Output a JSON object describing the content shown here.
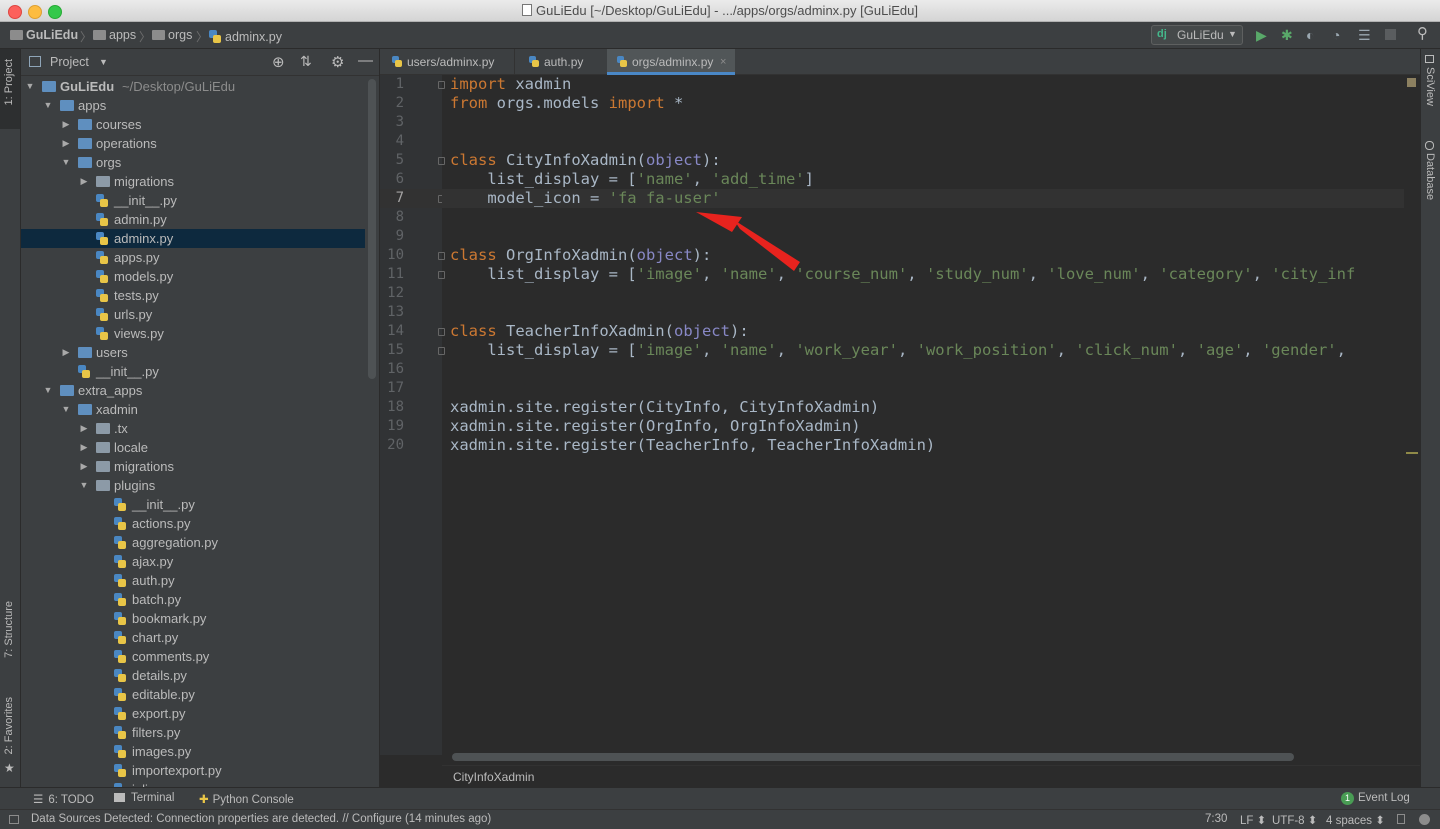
{
  "window": {
    "title": "GuLiEdu [~/Desktop/GuLiEdu] - .../apps/orgs/adminx.py [GuLiEdu]"
  },
  "navbar": {
    "crumbs": [
      "GuLiEdu",
      "apps",
      "orgs",
      "adminx.py"
    ],
    "run_config": "GuLiEdu",
    "run_config_badge": "dj"
  },
  "left_strip": {
    "project_tab": "1: Project",
    "structure_tab": "7: Structure",
    "favorites_tab": "2: Favorites"
  },
  "project_panel": {
    "header_label": "Project",
    "tree": [
      {
        "label": "GuLiEdu",
        "suffix": "~/Desktop/GuLiEdu",
        "depth": 0,
        "kind": "folder",
        "arrow": "down",
        "bold": true
      },
      {
        "label": "apps",
        "depth": 1,
        "kind": "folder",
        "arrow": "down"
      },
      {
        "label": "courses",
        "depth": 2,
        "kind": "folder",
        "arrow": "right"
      },
      {
        "label": "operations",
        "depth": 2,
        "kind": "folder",
        "arrow": "right"
      },
      {
        "label": "orgs",
        "depth": 2,
        "kind": "folder",
        "arrow": "down"
      },
      {
        "label": "migrations",
        "depth": 3,
        "kind": "folder",
        "arrow": "right"
      },
      {
        "label": "__init__.py",
        "depth": 3,
        "kind": "py"
      },
      {
        "label": "admin.py",
        "depth": 3,
        "kind": "py"
      },
      {
        "label": "adminx.py",
        "depth": 3,
        "kind": "py",
        "selected": true
      },
      {
        "label": "apps.py",
        "depth": 3,
        "kind": "py"
      },
      {
        "label": "models.py",
        "depth": 3,
        "kind": "py"
      },
      {
        "label": "tests.py",
        "depth": 3,
        "kind": "py"
      },
      {
        "label": "urls.py",
        "depth": 3,
        "kind": "py"
      },
      {
        "label": "views.py",
        "depth": 3,
        "kind": "py"
      },
      {
        "label": "users",
        "depth": 2,
        "kind": "folder",
        "arrow": "right"
      },
      {
        "label": "__init__.py",
        "depth": 2,
        "kind": "py"
      },
      {
        "label": "extra_apps",
        "depth": 1,
        "kind": "folder",
        "arrow": "down"
      },
      {
        "label": "xadmin",
        "depth": 2,
        "kind": "folder",
        "arrow": "down"
      },
      {
        "label": ".tx",
        "depth": 3,
        "kind": "folder",
        "arrow": "right"
      },
      {
        "label": "locale",
        "depth": 3,
        "kind": "folder",
        "arrow": "right"
      },
      {
        "label": "migrations",
        "depth": 3,
        "kind": "folder",
        "arrow": "right"
      },
      {
        "label": "plugins",
        "depth": 3,
        "kind": "folder",
        "arrow": "down"
      },
      {
        "label": "__init__.py",
        "depth": 4,
        "kind": "py"
      },
      {
        "label": "actions.py",
        "depth": 4,
        "kind": "py"
      },
      {
        "label": "aggregation.py",
        "depth": 4,
        "kind": "py"
      },
      {
        "label": "ajax.py",
        "depth": 4,
        "kind": "py"
      },
      {
        "label": "auth.py",
        "depth": 4,
        "kind": "py"
      },
      {
        "label": "batch.py",
        "depth": 4,
        "kind": "py"
      },
      {
        "label": "bookmark.py",
        "depth": 4,
        "kind": "py"
      },
      {
        "label": "chart.py",
        "depth": 4,
        "kind": "py"
      },
      {
        "label": "comments.py",
        "depth": 4,
        "kind": "py"
      },
      {
        "label": "details.py",
        "depth": 4,
        "kind": "py"
      },
      {
        "label": "editable.py",
        "depth": 4,
        "kind": "py"
      },
      {
        "label": "export.py",
        "depth": 4,
        "kind": "py"
      },
      {
        "label": "filters.py",
        "depth": 4,
        "kind": "py"
      },
      {
        "label": "images.py",
        "depth": 4,
        "kind": "py"
      },
      {
        "label": "importexport.py",
        "depth": 4,
        "kind": "py"
      },
      {
        "label": "inline.py",
        "depth": 4,
        "kind": "py"
      }
    ]
  },
  "editor": {
    "tabs": [
      {
        "label": "users/adminx.py",
        "active": false
      },
      {
        "label": "auth.py",
        "active": false
      },
      {
        "label": "orgs/adminx.py",
        "active": true
      }
    ],
    "current_line": 7,
    "lines": [
      [
        [
          "kw",
          "import"
        ],
        [
          "t",
          " xadmin"
        ]
      ],
      [
        [
          "kw",
          "from"
        ],
        [
          "t",
          " orgs.models "
        ],
        [
          "kw",
          "import"
        ],
        [
          "t",
          " *"
        ]
      ],
      [],
      [],
      [
        [
          "kw",
          "class"
        ],
        [
          "t",
          " CityInfoXadmin("
        ],
        [
          "bi",
          "object"
        ],
        [
          "t",
          "):"
        ]
      ],
      [
        [
          "t",
          "    list_display = ["
        ],
        [
          "str",
          "'name'"
        ],
        [
          "t",
          ", "
        ],
        [
          "str",
          "'add_time'"
        ],
        [
          "t",
          "]"
        ]
      ],
      [
        [
          "t",
          "    model_icon = "
        ],
        [
          "str",
          "'fa fa-user'"
        ]
      ],
      [],
      [],
      [
        [
          "kw",
          "class"
        ],
        [
          "t",
          " OrgInfoXadmin("
        ],
        [
          "bi",
          "object"
        ],
        [
          "t",
          "):"
        ]
      ],
      [
        [
          "t",
          "    list_display = ["
        ],
        [
          "str",
          "'image'"
        ],
        [
          "t",
          ", "
        ],
        [
          "str",
          "'name'"
        ],
        [
          "t",
          ", "
        ],
        [
          "str",
          "'course_num'"
        ],
        [
          "t",
          ", "
        ],
        [
          "str",
          "'study_num'"
        ],
        [
          "t",
          ", "
        ],
        [
          "str",
          "'love_num'"
        ],
        [
          "t",
          ", "
        ],
        [
          "str",
          "'category'"
        ],
        [
          "t",
          ", "
        ],
        [
          "str",
          "'city_inf"
        ]
      ],
      [],
      [],
      [
        [
          "kw",
          "class"
        ],
        [
          "t",
          " TeacherInfoXadmin("
        ],
        [
          "bi",
          "object"
        ],
        [
          "t",
          "):"
        ]
      ],
      [
        [
          "t",
          "    list_display = ["
        ],
        [
          "str",
          "'image'"
        ],
        [
          "t",
          ", "
        ],
        [
          "str",
          "'name'"
        ],
        [
          "t",
          ", "
        ],
        [
          "str",
          "'work_year'"
        ],
        [
          "t",
          ", "
        ],
        [
          "str",
          "'work_position'"
        ],
        [
          "t",
          ", "
        ],
        [
          "str",
          "'click_num'"
        ],
        [
          "t",
          ", "
        ],
        [
          "str",
          "'age'"
        ],
        [
          "t",
          ", "
        ],
        [
          "str",
          "'gender'"
        ],
        [
          "t",
          ","
        ]
      ],
      [],
      [],
      [
        [
          "t",
          "xadmin.site.register(CityInfo, CityInfoXadmin)"
        ]
      ],
      [
        [
          "t",
          "xadmin.site.register(OrgInfo, OrgInfoXadmin)"
        ]
      ],
      [
        [
          "t",
          "xadmin.site.register(TeacherInfo, TeacherInfoXadmin)"
        ]
      ]
    ],
    "breadcrumb": "CityInfoXadmin"
  },
  "right_strip": {
    "sciview_tab": "SciView",
    "database_tab": "Database"
  },
  "bottom_tools": {
    "todo": "6: TODO",
    "terminal": "Terminal",
    "python_console": "Python Console",
    "event_log": "Event Log",
    "event_log_count": "1"
  },
  "status": {
    "message": "Data Sources Detected: Connection properties are detected. // Configure (14 minutes ago)",
    "position": "7:30",
    "line_sep": "LF",
    "encoding": "UTF-8",
    "indent": "4 spaces"
  },
  "colors": {
    "accent": "#4a88c7",
    "annotation_arrow": "#e8231e",
    "keyword": "#cc7832",
    "string": "#6a8759",
    "builtin": "#8888c6"
  }
}
